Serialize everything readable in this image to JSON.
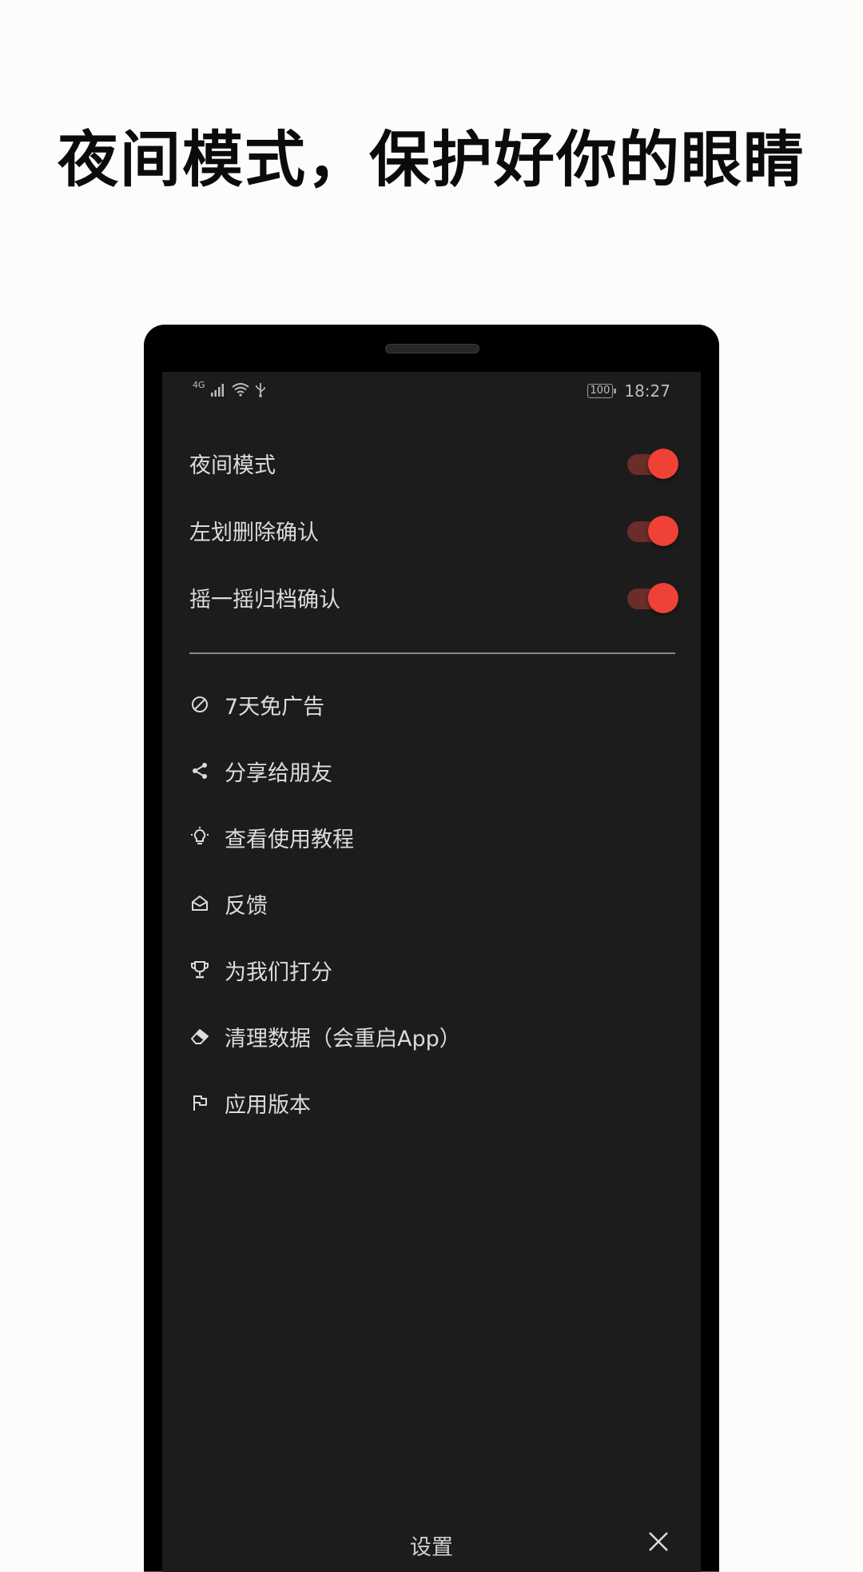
{
  "headline": "夜间模式，保护好你的眼睛",
  "status_bar": {
    "network": "4G",
    "time": "18:27",
    "battery": "100"
  },
  "toggles": [
    {
      "label": "夜间模式",
      "on": true
    },
    {
      "label": "左划删除确认",
      "on": true
    },
    {
      "label": "摇一摇归档确认",
      "on": true
    }
  ],
  "menu": [
    {
      "icon": "block-icon",
      "label": "7天免广告"
    },
    {
      "icon": "share-icon",
      "label": "分享给朋友"
    },
    {
      "icon": "lightbulb-icon",
      "label": "查看使用教程"
    },
    {
      "icon": "mail-open-icon",
      "label": "反馈"
    },
    {
      "icon": "trophy-icon",
      "label": "为我们打分"
    },
    {
      "icon": "eraser-icon",
      "label": "清理数据（会重启App）"
    },
    {
      "icon": "flag-icon",
      "label": "应用版本"
    }
  ],
  "bottom_bar": {
    "title": "设置"
  },
  "colors": {
    "accent": "#ef4136",
    "track": "#6a2d2a",
    "screen_bg": "#1c1c1c",
    "page_bg": "#fdfcfa"
  }
}
